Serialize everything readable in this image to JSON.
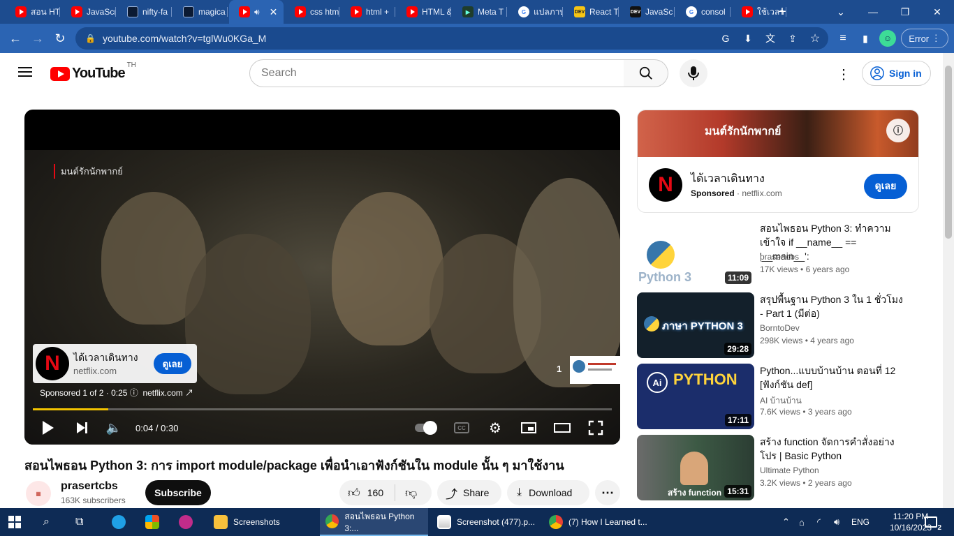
{
  "browser": {
    "tabs": [
      {
        "label": "สอน HT",
        "favicon": "yt"
      },
      {
        "label": "JavaScr",
        "favicon": "yt"
      },
      {
        "label": "nifty-fa",
        "favicon": "dark"
      },
      {
        "label": "magica",
        "favicon": "dark"
      },
      {
        "label": "",
        "favicon": "yt",
        "active": true
      },
      {
        "label": "css htm",
        "favicon": "yt"
      },
      {
        "label": "html +",
        "favicon": "yt"
      },
      {
        "label": "HTML &",
        "favicon": "yt"
      },
      {
        "label": "Meta T",
        "favicon": "meta"
      },
      {
        "label": "แปลภาษ",
        "favicon": "g"
      },
      {
        "label": "React T",
        "favicon": "react"
      },
      {
        "label": "JavaSc",
        "favicon": "dev"
      },
      {
        "label": "consol",
        "favicon": "g"
      },
      {
        "label": "ใช้เวลา",
        "favicon": "yt"
      }
    ],
    "url": "youtube.com/watch?v=tglWu0KGa_M",
    "error_label": "Error"
  },
  "youtube": {
    "logo_text": "YouTube",
    "region": "TH",
    "search_placeholder": "Search",
    "signin_label": "Sign in"
  },
  "player": {
    "overlay_title": "มนต์รักนักพากย์",
    "ad": {
      "title": "ได้เวลาเดินทาง",
      "domain": "netflix.com",
      "cta": "ดูเลย",
      "sponsor_text": "Sponsored 1 of 2 · 0:25",
      "sponsor_domain": "netflix.com",
      "logo_letter": "N"
    },
    "next_count": "1",
    "time": "0:04 / 0:30",
    "progress": 0.13
  },
  "video": {
    "title": "สอนไพธอน Python 3: การ import module/package เพื่อนำเอาฟังก์ชันใน module นั้น ๆ มาใช้งาน",
    "channel": "prasertcbs",
    "subscribers": "163K subscribers",
    "subscribe_label": "Subscribe",
    "likes": "160",
    "share_label": "Share",
    "download_label": "Download"
  },
  "sidebar": {
    "ad": {
      "banner_text": "มนต์รักนักพากย์",
      "title": "ได้เวลาเดินทาง",
      "sponsored": "Sponsored",
      "domain": "netflix.com",
      "cta": "ดูเลย",
      "logo_letter": "N"
    },
    "videos": [
      {
        "title": "สอนไพธอน Python 3: ทำความเข้าใจ if __name__ == '__main__':",
        "channel": "prasertcbs",
        "views": "17K views",
        "age": "6 years ago",
        "duration": "11:09",
        "thumb_text": "Python 3",
        "thumb_bg": "#ffffff"
      },
      {
        "title": "สรุปพื้นฐาน Python 3 ใน 1 ชั่วโมง - Part 1 (มีต่อ)",
        "channel": "BorntoDev",
        "views": "298K views",
        "age": "4 years ago",
        "duration": "29:28",
        "thumb_text": "ภาษา PYTHON 3",
        "thumb_bg": "#13202b"
      },
      {
        "title": "Python...แบบบ้านบ้าน ตอนที่ 12 [ฟังก์ชัน def]",
        "channel": "AI บ้านบ้าน",
        "views": "7.6K views",
        "age": "3 years ago",
        "duration": "17:11",
        "thumb_text": "PYTHON",
        "thumb_bg": "#1b2d6b"
      },
      {
        "title": "สร้าง function จัดการคำสั่งอย่างโปร | Basic Python",
        "channel": "Ultimate Python",
        "views": "3.2K views",
        "age": "2 years ago",
        "duration": "15:31",
        "thumb_text": "สร้าง function",
        "thumb_bg": "#3d5a45"
      }
    ]
  },
  "taskbar": {
    "items": [
      {
        "label": "Screenshots"
      },
      {
        "label": "สอนไพธอน Python 3:...",
        "active": true
      },
      {
        "label": "Screenshot (477).p..."
      },
      {
        "label": "(7) How I Learned t..."
      }
    ],
    "language": "ENG",
    "time": "11:20 PM",
    "date": "10/16/2023",
    "notifications": "2"
  }
}
